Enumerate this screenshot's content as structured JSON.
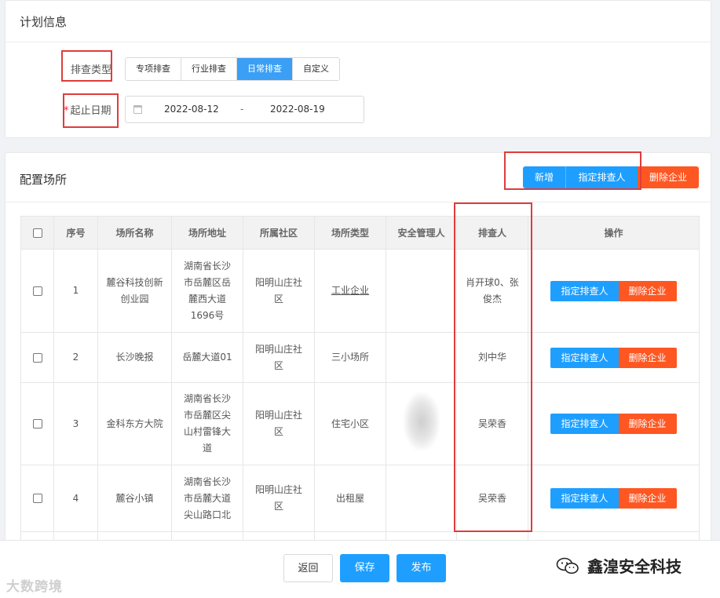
{
  "plan_card": {
    "title": "计划信息",
    "check_type": {
      "label": "排查类型",
      "options": [
        "专项排查",
        "行业排查",
        "日常排查",
        "自定义"
      ],
      "selected": "日常排查"
    },
    "date": {
      "required_mark": "*",
      "label": "起止日期",
      "start": "2022-08-12",
      "separator": "-",
      "end": "2022-08-19"
    }
  },
  "venue_card": {
    "title": "配置场所",
    "toolbar": {
      "add_label": "新增",
      "assign_label": "指定排查人",
      "delete_label": "删除企业"
    },
    "table": {
      "headers": [
        "",
        "序号",
        "场所名称",
        "场所地址",
        "所属社区",
        "场所类型",
        "安全管理人",
        "排查人",
        "操作"
      ],
      "rows": [
        {
          "index": "1",
          "name": "麓谷科技创新创业园",
          "address": "湖南省长沙市岳麓区岳麓西大道1696号",
          "community": "阳明山庄社区",
          "type": "工业企业",
          "manager": "",
          "inspector": "肖开球0、张俊杰"
        },
        {
          "index": "2",
          "name": "长沙晚报",
          "address": "岳麓大道01",
          "community": "阳明山庄社区",
          "type": "三小场所",
          "manager": "",
          "inspector": "刘中华"
        },
        {
          "index": "3",
          "name": "金科东方大院",
          "address": "湖南省长沙市岳麓区尖山村雷锋大道",
          "community": "阳明山庄社区",
          "type": "住宅小区",
          "manager": "",
          "inspector": "吴荣香"
        },
        {
          "index": "4",
          "name": "麓谷小镇",
          "address": "湖南省长沙市岳麓大道尖山路口北",
          "community": "阳明山庄社区",
          "type": "出租屋",
          "manager": "",
          "inspector": "吴荣香"
        }
      ],
      "row_actions": {
        "assign": "指定排查人",
        "delete": "删除企业"
      }
    }
  },
  "footer": {
    "back_label": "返回",
    "save_label": "保存",
    "publish_label": "发布"
  },
  "watermarks": {
    "left": "大数跨境",
    "right": "鑫湟安全科技"
  },
  "colors": {
    "primary": "#1e9fff",
    "danger": "#ff5722",
    "annotation": "#e03c3c"
  }
}
